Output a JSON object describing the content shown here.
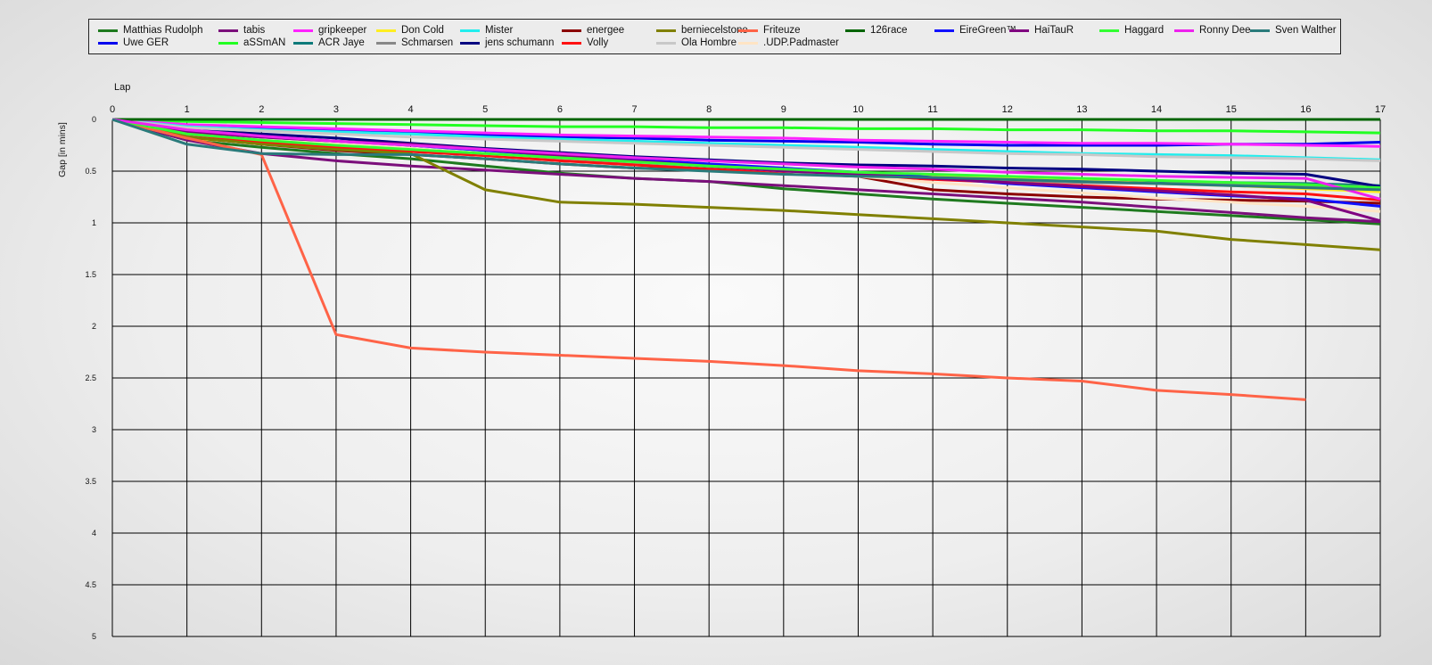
{
  "chart_data": {
    "type": "line",
    "xlabel": "Lap",
    "ylabel": "Gap [in mins]",
    "x": [
      0,
      1,
      2,
      3,
      4,
      5,
      6,
      7,
      8,
      9,
      10,
      11,
      12,
      13,
      14,
      15,
      16,
      17
    ],
    "xlim": [
      0,
      17
    ],
    "ylim": [
      0,
      5
    ],
    "y_inverted": true,
    "y_ticks": [
      "0",
      "0.5",
      "1",
      "1.5",
      "2",
      "2.5",
      "3",
      "3.5",
      "4",
      "4.5",
      "5"
    ],
    "x_ticks": [
      "0",
      "1",
      "2",
      "3",
      "4",
      "5",
      "6",
      "7",
      "8",
      "9",
      "10",
      "11",
      "12",
      "13",
      "14",
      "15",
      "16",
      "17"
    ],
    "grid": true,
    "legend_position": "top",
    "series": [
      {
        "name": "Matthias  Rudolph",
        "color": "#1f7a1f",
        "values": [
          0,
          0.2,
          0.27,
          0.33,
          0.38,
          0.45,
          0.52,
          0.57,
          0.6,
          0.67,
          0.72,
          0.77,
          0.81,
          0.85,
          0.89,
          0.93,
          0.97,
          1.01
        ]
      },
      {
        "name": "Uwe GER",
        "color": "#0000ee",
        "values": [
          0,
          0.06,
          0.08,
          0.1,
          0.13,
          0.15,
          0.17,
          0.18,
          0.2,
          0.21,
          0.22,
          0.24,
          0.25,
          0.25,
          0.25,
          0.24,
          0.24,
          0.22
        ]
      },
      {
        "name": "tabis",
        "color": "#7b0f7b",
        "values": [
          0,
          0.2,
          0.33,
          0.4,
          0.45,
          0.49,
          0.53,
          0.57,
          0.6,
          0.64,
          0.68,
          0.72,
          0.76,
          0.8,
          0.85,
          0.9,
          0.95,
          0.99
        ]
      },
      {
        "name": "aSSmAN",
        "color": "#22ff22",
        "values": [
          0,
          0.02,
          0.03,
          0.04,
          0.05,
          0.06,
          0.07,
          0.07,
          0.08,
          0.08,
          0.09,
          0.09,
          0.1,
          0.1,
          0.11,
          0.11,
          0.12,
          0.13
        ]
      },
      {
        "name": "gripkeeper",
        "color": "#ff22ff",
        "values": [
          0,
          0.05,
          0.07,
          0.09,
          0.11,
          0.13,
          0.15,
          0.16,
          0.17,
          0.18,
          0.2,
          0.21,
          0.22,
          0.23,
          0.23,
          0.24,
          0.25,
          0.26
        ]
      },
      {
        "name": "ACR Jaye",
        "color": "#0e7a7a",
        "values": [
          0,
          0.13,
          0.2,
          0.25,
          0.28,
          0.33,
          0.38,
          0.42,
          0.46,
          0.5,
          0.53,
          0.55,
          0.57,
          0.59,
          0.6,
          0.61,
          0.62,
          0.64
        ]
      },
      {
        "name": "Don Cold",
        "color": "#ffee22",
        "values": [
          0,
          0.18,
          0.23,
          0.27,
          0.29,
          0.33,
          0.37,
          0.41,
          0.45,
          0.49,
          0.52,
          0.55,
          0.57,
          0.59,
          0.62,
          0.64,
          0.67,
          0.7
        ]
      },
      {
        "name": "Schmarsen",
        "color": "#888888",
        "values": [
          0,
          0.16,
          0.2,
          0.24,
          0.28,
          0.33,
          0.38,
          0.43,
          0.48,
          0.52,
          0.55,
          0.57,
          0.59,
          0.61,
          0.62,
          0.63,
          0.64,
          0.65
        ]
      },
      {
        "name": "Mister",
        "color": "#22eeee",
        "values": [
          0,
          0.07,
          0.1,
          0.12,
          0.14,
          0.17,
          0.19,
          0.21,
          0.23,
          0.25,
          0.27,
          0.29,
          0.31,
          0.33,
          0.34,
          0.35,
          0.37,
          0.39
        ]
      },
      {
        "name": "jens  schumann",
        "color": "#000080",
        "values": [
          0,
          0.1,
          0.14,
          0.18,
          0.23,
          0.28,
          0.32,
          0.36,
          0.39,
          0.42,
          0.44,
          0.45,
          0.47,
          0.48,
          0.5,
          0.52,
          0.53,
          0.65
        ]
      },
      {
        "name": "energee",
        "color": "#8b0000",
        "values": [
          0,
          0.17,
          0.24,
          0.3,
          0.34,
          0.38,
          0.43,
          0.47,
          0.49,
          0.52,
          0.55,
          0.68,
          0.72,
          0.75,
          0.77,
          0.78,
          0.79,
          0.81
        ]
      },
      {
        "name": "Volly",
        "color": "#ff1111",
        "values": [
          0,
          0.14,
          0.22,
          0.27,
          0.31,
          0.35,
          0.4,
          0.44,
          0.48,
          0.51,
          0.54,
          0.58,
          0.61,
          0.64,
          0.67,
          0.7,
          0.72,
          0.78
        ]
      },
      {
        "name": "berniecelstone",
        "color": "#808000",
        "values": [
          0,
          0.17,
          0.24,
          0.29,
          0.33,
          0.68,
          0.8,
          0.82,
          0.85,
          0.88,
          0.92,
          0.96,
          1.0,
          1.04,
          1.08,
          1.16,
          1.21,
          1.26
        ]
      },
      {
        "name": "Ola Hombre",
        "color": "#c8c8c8",
        "values": [
          0,
          0.08,
          0.11,
          0.14,
          0.17,
          0.19,
          0.21,
          0.23,
          0.25,
          0.27,
          0.29,
          0.31,
          0.33,
          0.34,
          0.36,
          0.37,
          0.38,
          0.4
        ]
      },
      {
        "name": "Friteuze",
        "color": "#ff6347",
        "values": [
          0,
          0.18,
          0.34,
          2.08,
          2.21,
          2.25,
          2.28,
          2.31,
          2.34,
          2.38,
          2.43,
          2.46,
          2.5,
          2.53,
          2.62,
          2.66,
          2.71,
          null
        ]
      },
      {
        "name": ".UDP.Padmaster",
        "color": "#ffe4c4",
        "values": [
          0,
          0.12,
          0.18,
          0.23,
          0.28,
          0.33,
          0.37,
          0.41,
          0.45,
          0.5,
          0.55,
          0.61,
          0.66,
          0.71,
          0.76,
          0.8,
          0.84,
          0.89
        ]
      },
      {
        "name": "126race",
        "color": "#006400",
        "values": [
          0,
          0,
          0,
          0,
          0,
          0,
          0,
          0,
          0,
          0,
          0,
          0,
          0,
          0,
          0,
          0,
          0,
          0
        ]
      },
      {
        "name": "EireGreen™",
        "color": "#1010ff",
        "values": [
          0,
          0.12,
          0.17,
          0.21,
          0.25,
          0.3,
          0.35,
          0.39,
          0.43,
          0.47,
          0.51,
          0.56,
          0.62,
          0.66,
          0.7,
          0.74,
          0.77,
          0.84
        ]
      },
      {
        "name": "HaiTauR",
        "color": "#800080",
        "values": [
          0,
          0.12,
          0.17,
          0.21,
          0.24,
          0.29,
          0.35,
          0.4,
          0.45,
          0.5,
          0.53,
          0.57,
          0.61,
          0.65,
          0.69,
          0.73,
          0.78,
          0.98
        ]
      },
      {
        "name": "Haggard",
        "color": "#33ff33",
        "values": [
          0,
          0.14,
          0.2,
          0.25,
          0.29,
          0.33,
          0.37,
          0.41,
          0.45,
          0.48,
          0.51,
          0.53,
          0.55,
          0.57,
          0.59,
          0.61,
          0.63,
          0.66
        ]
      },
      {
        "name": "Ronny Dee",
        "color": "#ee22ee",
        "values": [
          0,
          0.1,
          0.16,
          0.21,
          0.25,
          0.29,
          0.33,
          0.37,
          0.4,
          0.43,
          0.46,
          0.48,
          0.51,
          0.53,
          0.55,
          0.56,
          0.57,
          0.77
        ]
      },
      {
        "name": "Sven Walther",
        "color": "#2a7b7b",
        "values": [
          0,
          0.24,
          0.33,
          0.34,
          0.34,
          0.38,
          0.43,
          0.47,
          0.5,
          0.53,
          0.55,
          0.56,
          0.58,
          0.6,
          0.62,
          0.64,
          0.66,
          0.68
        ]
      }
    ]
  }
}
